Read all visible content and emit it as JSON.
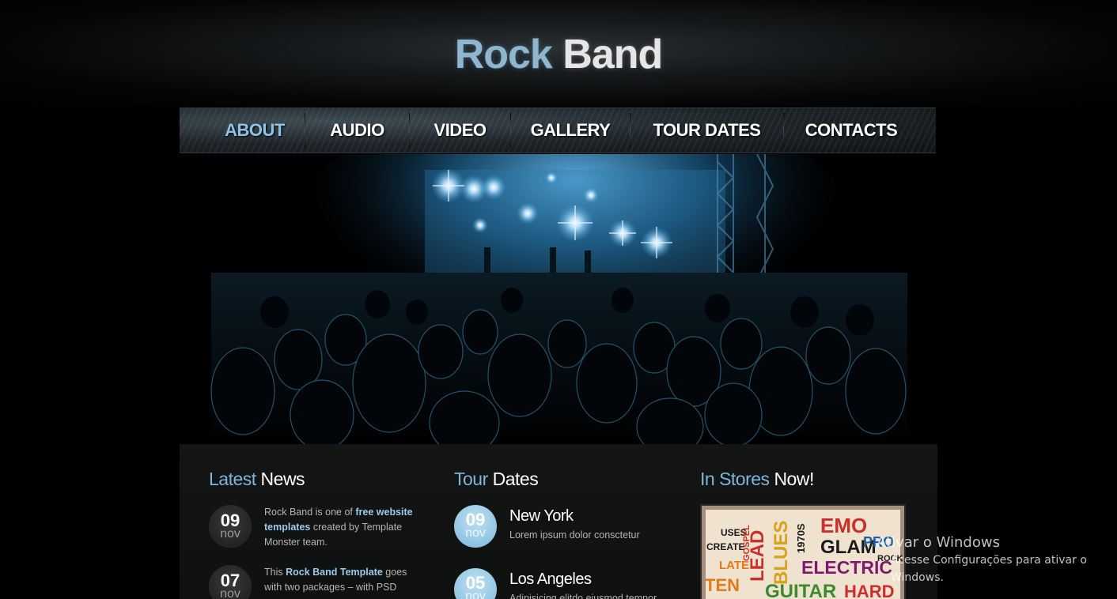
{
  "header": {
    "logo_word1": "Rock",
    "logo_word2": "Band"
  },
  "nav": {
    "items": [
      {
        "label": "ABOUT",
        "active": true
      },
      {
        "label": "AUDIO",
        "active": false
      },
      {
        "label": "VIDEO",
        "active": false
      },
      {
        "label": "GALLERY",
        "active": false
      },
      {
        "label": "TOUR DATES",
        "active": false
      },
      {
        "label": "CONTACTS",
        "active": false
      }
    ]
  },
  "news": {
    "title_highlight": "Latest",
    "title_rest": "News",
    "items": [
      {
        "day": "09",
        "month": "nov",
        "text_pre": "Rock Band is one of ",
        "link": "free website templates",
        "text_post": " created by Template Monster team."
      },
      {
        "day": "07",
        "month": "nov",
        "text_pre": "This ",
        "link": "Rock Band Template",
        "text_post": " goes with two packages – with PSD"
      }
    ]
  },
  "tour": {
    "title_highlight": "Tour",
    "title_rest": "Dates",
    "items": [
      {
        "day": "09",
        "month": "nov",
        "city": "New York",
        "desc": "Lorem ipsum dolor consctetur"
      },
      {
        "day": "05",
        "month": "nov",
        "city": "Los Angeles",
        "desc": "Adipisicing elitdo eiusmod tempor"
      }
    ]
  },
  "stores": {
    "title_highlight": "In Stores",
    "title_rest": "Now!",
    "album_words": [
      "EMO",
      "GLAM",
      "LEAD",
      "BLUES",
      "1970S",
      "ELECTRIC",
      "GUITAR",
      "HARD",
      "TEN",
      "LATE",
      "CREATE",
      "USES",
      "GOSPEL",
      "PRO",
      "ROCK"
    ]
  },
  "watermark": {
    "line1": "Ativar o Windows",
    "line2": "Acesse Configurações para ativar o Windows."
  },
  "colors": {
    "accent": "#7fb6da",
    "background": "#000000",
    "panel": "#141515"
  }
}
